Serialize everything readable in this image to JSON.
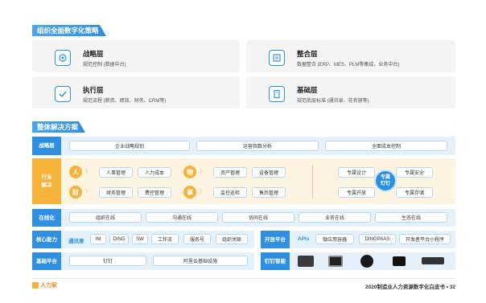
{
  "section1": {
    "title": "组织全面数字化策略",
    "cards": [
      {
        "title": "战略层",
        "desc": "规范控制 (数据中台)"
      },
      {
        "title": "整合层",
        "desc": "数据整合 (ERP、MES、PLM等集成，业务中台)"
      },
      {
        "title": "执行层",
        "desc": "规范流程 (薪资、绩效、财务、CRM等)"
      },
      {
        "title": "基础层",
        "desc": "规范底层标准 (通讯录、花名册等)"
      }
    ]
  },
  "section2": {
    "title": "整体解决方案"
  },
  "strategy": {
    "label": "战略层",
    "items": [
      "企业战略规划",
      "运营指数分析",
      "全面成本控制"
    ]
  },
  "industry": {
    "label": "行业解决",
    "glyphs": [
      "人",
      "物",
      "财",
      "事"
    ],
    "items": [
      "人事管理",
      "人力成本",
      "资产管理",
      "设备管理",
      "财务管理",
      "费控管理",
      "监控巡检",
      "售后管理"
    ],
    "dedicated": [
      "专属设计",
      "专属安全",
      "专属开放",
      "专属存储"
    ],
    "center": "专属钉钉"
  },
  "online": {
    "label": "在线化",
    "items": [
      "组织在线",
      "沟通在线",
      "协同在线",
      "业务在线",
      "生态在线"
    ]
  },
  "core": {
    "label": "核心能力",
    "sub": "通讯录",
    "items": [
      "IM",
      "DING",
      "SW",
      "工作流",
      "服务号",
      "组织关联"
    ]
  },
  "open": {
    "label": "开放平台",
    "sub": "APIs",
    "items": [
      "微应用容器",
      "DINGPAAS",
      "开发者平台小程序"
    ]
  },
  "base": {
    "label": "基础平台",
    "items": [
      "钉钉",
      "阿里云基础设施"
    ]
  },
  "hardware": {
    "label": "钉钉智能"
  },
  "footer": {
    "logo": "人力家",
    "text": "2020制造业人力资源数字化白皮书 • 32"
  },
  "colors": {
    "accent": "#2d8fe0",
    "light": "#e4f1fb",
    "orange": "#f6b23b"
  }
}
